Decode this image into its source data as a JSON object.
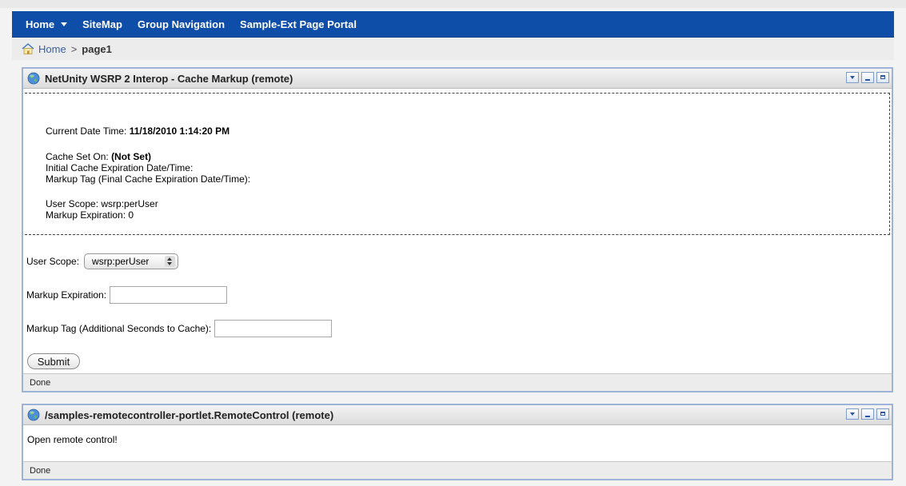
{
  "nav": {
    "items": [
      {
        "label": "Home",
        "has_caret": true
      },
      {
        "label": "SiteMap"
      },
      {
        "label": "Group Navigation"
      },
      {
        "label": "Sample-Ext Page Portal"
      }
    ]
  },
  "breadcrumb": {
    "home": "Home",
    "separator": ">",
    "current": "page1"
  },
  "portlet1": {
    "title": "NetUnity WSRP 2 Interop - Cache Markup (remote)",
    "current_date_label": "Current Date Time:",
    "current_date_value": "11/18/2010 1:14:20 PM",
    "cache_set_label": "Cache Set On:",
    "cache_set_value": "(Not Set)",
    "initial_expiration": "Initial Cache Expiration Date/Time:",
    "markup_tag_final": "Markup Tag (Final Cache Expiration Date/Time):",
    "user_scope_text": "User Scope: wsrp:perUser",
    "markup_expiration_text": "Markup Expiration: 0",
    "form": {
      "user_scope_label": "User Scope:",
      "user_scope_value": "wsrp:perUser",
      "markup_expiration_label": "Markup Expiration:",
      "markup_expiration_value": "",
      "markup_tag_label": "Markup Tag (Additional Seconds to Cache):",
      "markup_tag_value": "",
      "submit_label": "Submit"
    },
    "status": "Done"
  },
  "portlet2": {
    "title": "/samples-remotecontroller-portlet.RemoteControl (remote)",
    "body": "Open remote control!",
    "status": "Done"
  },
  "colors": {
    "navbar": "#0e4ea8",
    "portlet_border": "#9db3d8"
  }
}
